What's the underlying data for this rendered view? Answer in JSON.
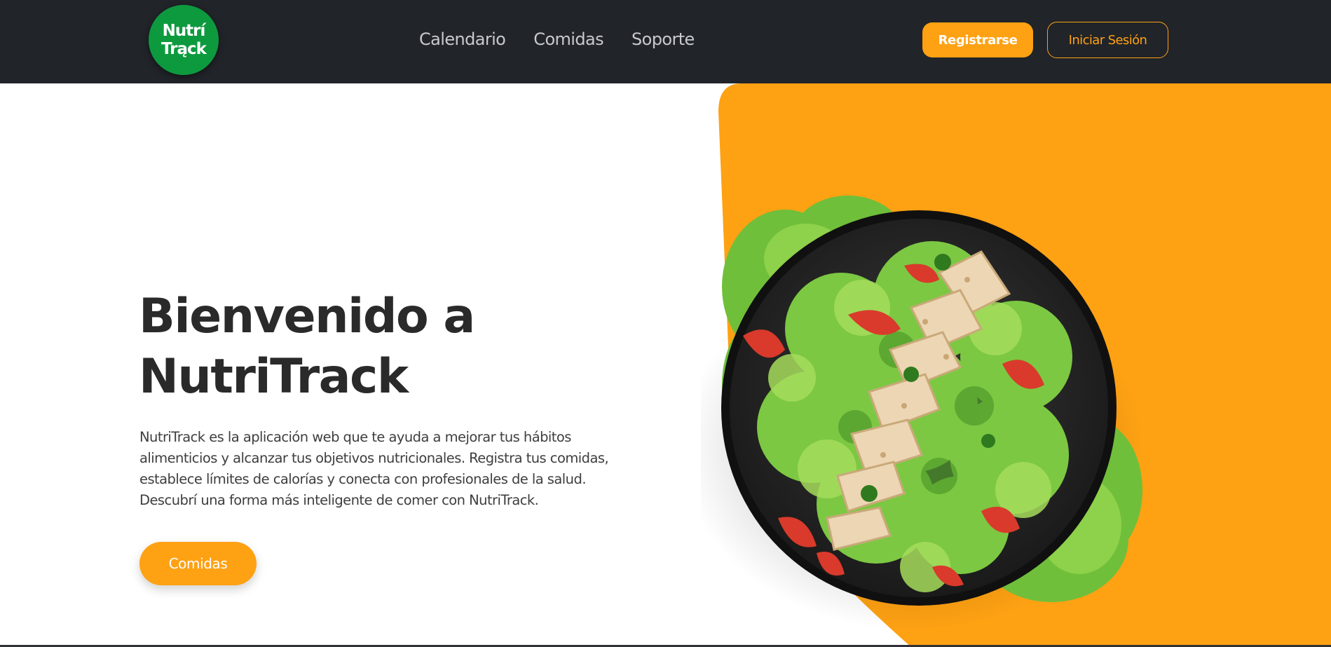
{
  "brand": {
    "logo_line1": "Nutrí",
    "logo_line2": "Trąck"
  },
  "nav": {
    "links": [
      "Calendario",
      "Comidas",
      "Soporte"
    ],
    "register_label": "Registrarse",
    "login_label": "Iniciar Sesión"
  },
  "hero": {
    "title_line1": "Bienvenido a",
    "title_line2": "NutriTrack",
    "description": "NutriTrack es la aplicación web que te ayuda a mejorar tus hábitos alimenticios y alcanzar tus objetivos nutricionales. Registra tus comidas, establece límites de calorías y conecta con profesionales de la salud. Descubrí una forma más inteligente de comer con NutriTrack.",
    "cta_label": "Comidas"
  },
  "colors": {
    "navbar_bg": "#212429",
    "accent": "#fea113",
    "logo_green": "#0d9a3e",
    "title": "#2a2a2a"
  },
  "icons": {
    "hero_image": "salad-bowl-image"
  }
}
